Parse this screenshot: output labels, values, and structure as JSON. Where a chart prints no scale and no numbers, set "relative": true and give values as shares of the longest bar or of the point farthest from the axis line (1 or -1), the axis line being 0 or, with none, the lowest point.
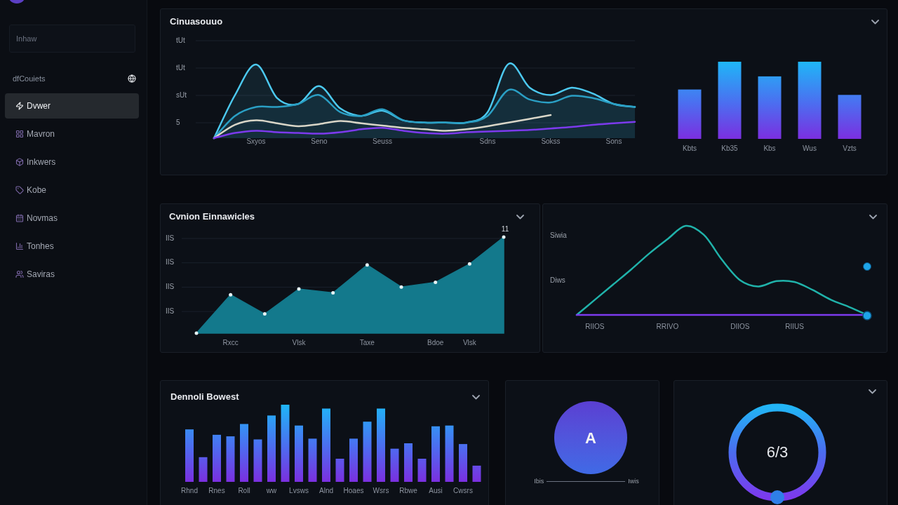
{
  "sidebar": {
    "search": {
      "placeholder": "Inhaw"
    },
    "section": {
      "title": "dfCouiets"
    },
    "items": [
      {
        "label": "Dvwer",
        "selected": true
      },
      {
        "label": "Mavron",
        "selected": false
      },
      {
        "label": "Inkwers",
        "selected": false
      },
      {
        "label": "Kobe",
        "selected": false
      },
      {
        "label": "Novmas",
        "selected": false
      },
      {
        "label": "Tonhes",
        "selected": false
      },
      {
        "label": "Saviras",
        "selected": false
      }
    ]
  },
  "overview_panel": {
    "title": "Cinuasouuo",
    "line_chart": {
      "y_axis_labels": [
        "tUt",
        "tUt",
        "sUt",
        "5"
      ],
      "chart_data": {
        "type": "line",
        "relative": true,
        "categories": [
          null,
          null,
          "Sxyos",
          null,
          null,
          "Seno",
          null,
          null,
          "Seuss",
          null,
          null,
          null,
          null,
          "Sdns",
          null,
          null,
          "Sokss",
          null,
          null,
          "Sons",
          null
        ],
        "series": [
          {
            "color": "#4cc9f0",
            "values": [
              0,
              0.58,
              0.99,
              0.54,
              0.46,
              0.7,
              0.4,
              0.3,
              0.37,
              0.24,
              0.21,
              0.21,
              0.21,
              0.35,
              1,
              0.68,
              0.58,
              0.68,
              0.6,
              0.46,
              0.42
            ]
          },
          {
            "color": "#2a9fc4",
            "values": [
              0,
              0.3,
              0.42,
              0.42,
              0.46,
              0.58,
              0.35,
              0.3,
              0.39,
              0.24,
              0.21,
              0.21,
              0.21,
              0.3,
              0.65,
              0.52,
              0.48,
              0.57,
              0.54,
              0.46,
              0.42
            ]
          },
          {
            "color": "#d9d6c8",
            "values": [
              0,
              0.18,
              0.24,
              0.2,
              0.16,
              0.19,
              0.23,
              0.2,
              0.17,
              0.14,
              0.12,
              0.1,
              0.12,
              0.16,
              0.21,
              0.26,
              0.31,
              null,
              null,
              null,
              null
            ]
          },
          {
            "color": "#7c3aed",
            "values": [
              0,
              0.07,
              0.1,
              0.08,
              0.07,
              0.06,
              0.08,
              0.12,
              0.14,
              0.1,
              0.07,
              0.06,
              0.08,
              0.09,
              0.1,
              0.11,
              0.13,
              0.15,
              0.18,
              0.2,
              0.22
            ]
          }
        ]
      }
    },
    "bar_chart": {
      "chart_data": {
        "type": "bar",
        "relative": true,
        "categories": [
          "Kbts",
          "Kb35",
          "Kbs",
          "Wus",
          "Vzts"
        ],
        "values": [
          0.64,
          1,
          0.81,
          1,
          0.57
        ]
      }
    }
  },
  "trend_panel": {
    "title": "Cvnion Einnawicles",
    "y_axis_labels": [
      "IIS",
      "IIS",
      "IIS",
      "IIS"
    ],
    "chart_data": {
      "type": "area",
      "relative": true,
      "categories": [
        null,
        "Rxcc",
        null,
        "Vlsk",
        null,
        "Taxe",
        null,
        "Bdoe",
        "Vlsk",
        null
      ],
      "series": [
        {
          "color": "#13798c",
          "values": [
            0,
            0.4,
            0.2,
            0.46,
            0.42,
            0.71,
            0.48,
            0.53,
            0.72,
            1
          ]
        }
      ],
      "value_labels": [
        null,
        null,
        null,
        null,
        null,
        null,
        null,
        null,
        null,
        "11"
      ]
    }
  },
  "curve_panel": {
    "y_axis_labels": [
      "Siwia",
      "Diws"
    ],
    "chart_data": {
      "type": "line",
      "relative": true,
      "categories": [
        null,
        "RIIOS",
        null,
        null,
        null,
        "RRIVO",
        null,
        null,
        null,
        "DIIOS",
        null,
        null,
        "RIIUS",
        null,
        null,
        null,
        null
      ],
      "series": [
        {
          "color": "#20b2aa",
          "values": [
            0,
            0.17,
            0.34,
            0.51,
            0.69,
            0.85,
            1,
            0.9,
            0.62,
            0.39,
            0.32,
            0.38,
            0.37,
            0.28,
            0.17,
            0.09,
            0
          ]
        },
        {
          "color": "#7c3aed",
          "values": [
            0,
            0,
            0,
            0,
            0,
            0,
            0,
            0,
            0,
            0,
            0,
            0,
            0,
            0,
            0,
            0,
            0
          ]
        }
      ]
    }
  },
  "bars_panel": {
    "title": "Dennoli Bowest",
    "chart_data": {
      "type": "bar",
      "relative": true,
      "categories": [
        "Rhnd",
        null,
        "Rnes",
        null,
        "Roll",
        null,
        "ww",
        null,
        "Lvsws",
        null,
        "Alnd",
        null,
        "Hoaes",
        null,
        "Wsrs",
        null,
        "Rbwe",
        null,
        "Ausi",
        null,
        "Cwsrs",
        null
      ],
      "values": [
        0.68,
        0.32,
        0.61,
        0.59,
        0.75,
        0.55,
        0.86,
        1,
        0.73,
        0.56,
        0.95,
        0.3,
        0.56,
        0.78,
        0.95,
        0.43,
        0.5,
        0.3,
        0.72,
        0.73,
        0.49,
        0.21
      ]
    }
  },
  "circle_panel": {
    "value": "A",
    "left_label": "Ibis",
    "right_label": "Iwis"
  },
  "gauge_panel": {
    "value": "6/3"
  }
}
